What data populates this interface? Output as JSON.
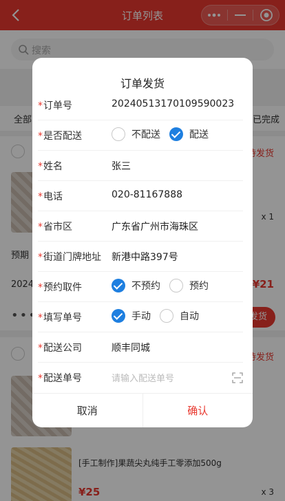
{
  "header": {
    "title": "订单列表"
  },
  "search": {
    "placeholder": "搜索"
  },
  "tabs": {
    "all": "全部",
    "done": "已完成"
  },
  "background": {
    "card1": {
      "status": "待发货",
      "qty": "x 1",
      "line1": "预期",
      "line2": "2024",
      "price": "¥21",
      "ship": "发货"
    },
    "card2": {
      "status": "待发货",
      "qty": "x 3",
      "product_name": "[手工制作]果蔬尖丸纯手工零添加500g",
      "price": "¥25"
    }
  },
  "dialog": {
    "title": "订单发货",
    "required_mark": "*",
    "fields": {
      "order_no": {
        "label": "订单号",
        "value": "20240513170109590023"
      },
      "delivery": {
        "label": "是否配送",
        "options": [
          "不配送",
          "配送"
        ],
        "selected": "配送"
      },
      "name": {
        "label": "姓名",
        "value": "张三"
      },
      "phone": {
        "label": "电话",
        "value": "020-81167888"
      },
      "region": {
        "label": "省市区",
        "value": "广东省广州市海珠区"
      },
      "street": {
        "label": "街道门牌地址",
        "value": "新港中路397号"
      },
      "pickup": {
        "label": "预约取件",
        "options": [
          "不预约",
          "预约"
        ],
        "selected": "不预约"
      },
      "fill_no": {
        "label": "填写单号",
        "options": [
          "手动",
          "自动"
        ],
        "selected": "手动"
      },
      "company": {
        "label": "配送公司",
        "value": "顺丰同城"
      },
      "tracking": {
        "label": "配送单号",
        "placeholder": "请输入配送单号"
      }
    },
    "cancel": "取消",
    "confirm": "确认"
  },
  "colors": {
    "brand": "#e8382f",
    "check": "#1e7fe0"
  }
}
